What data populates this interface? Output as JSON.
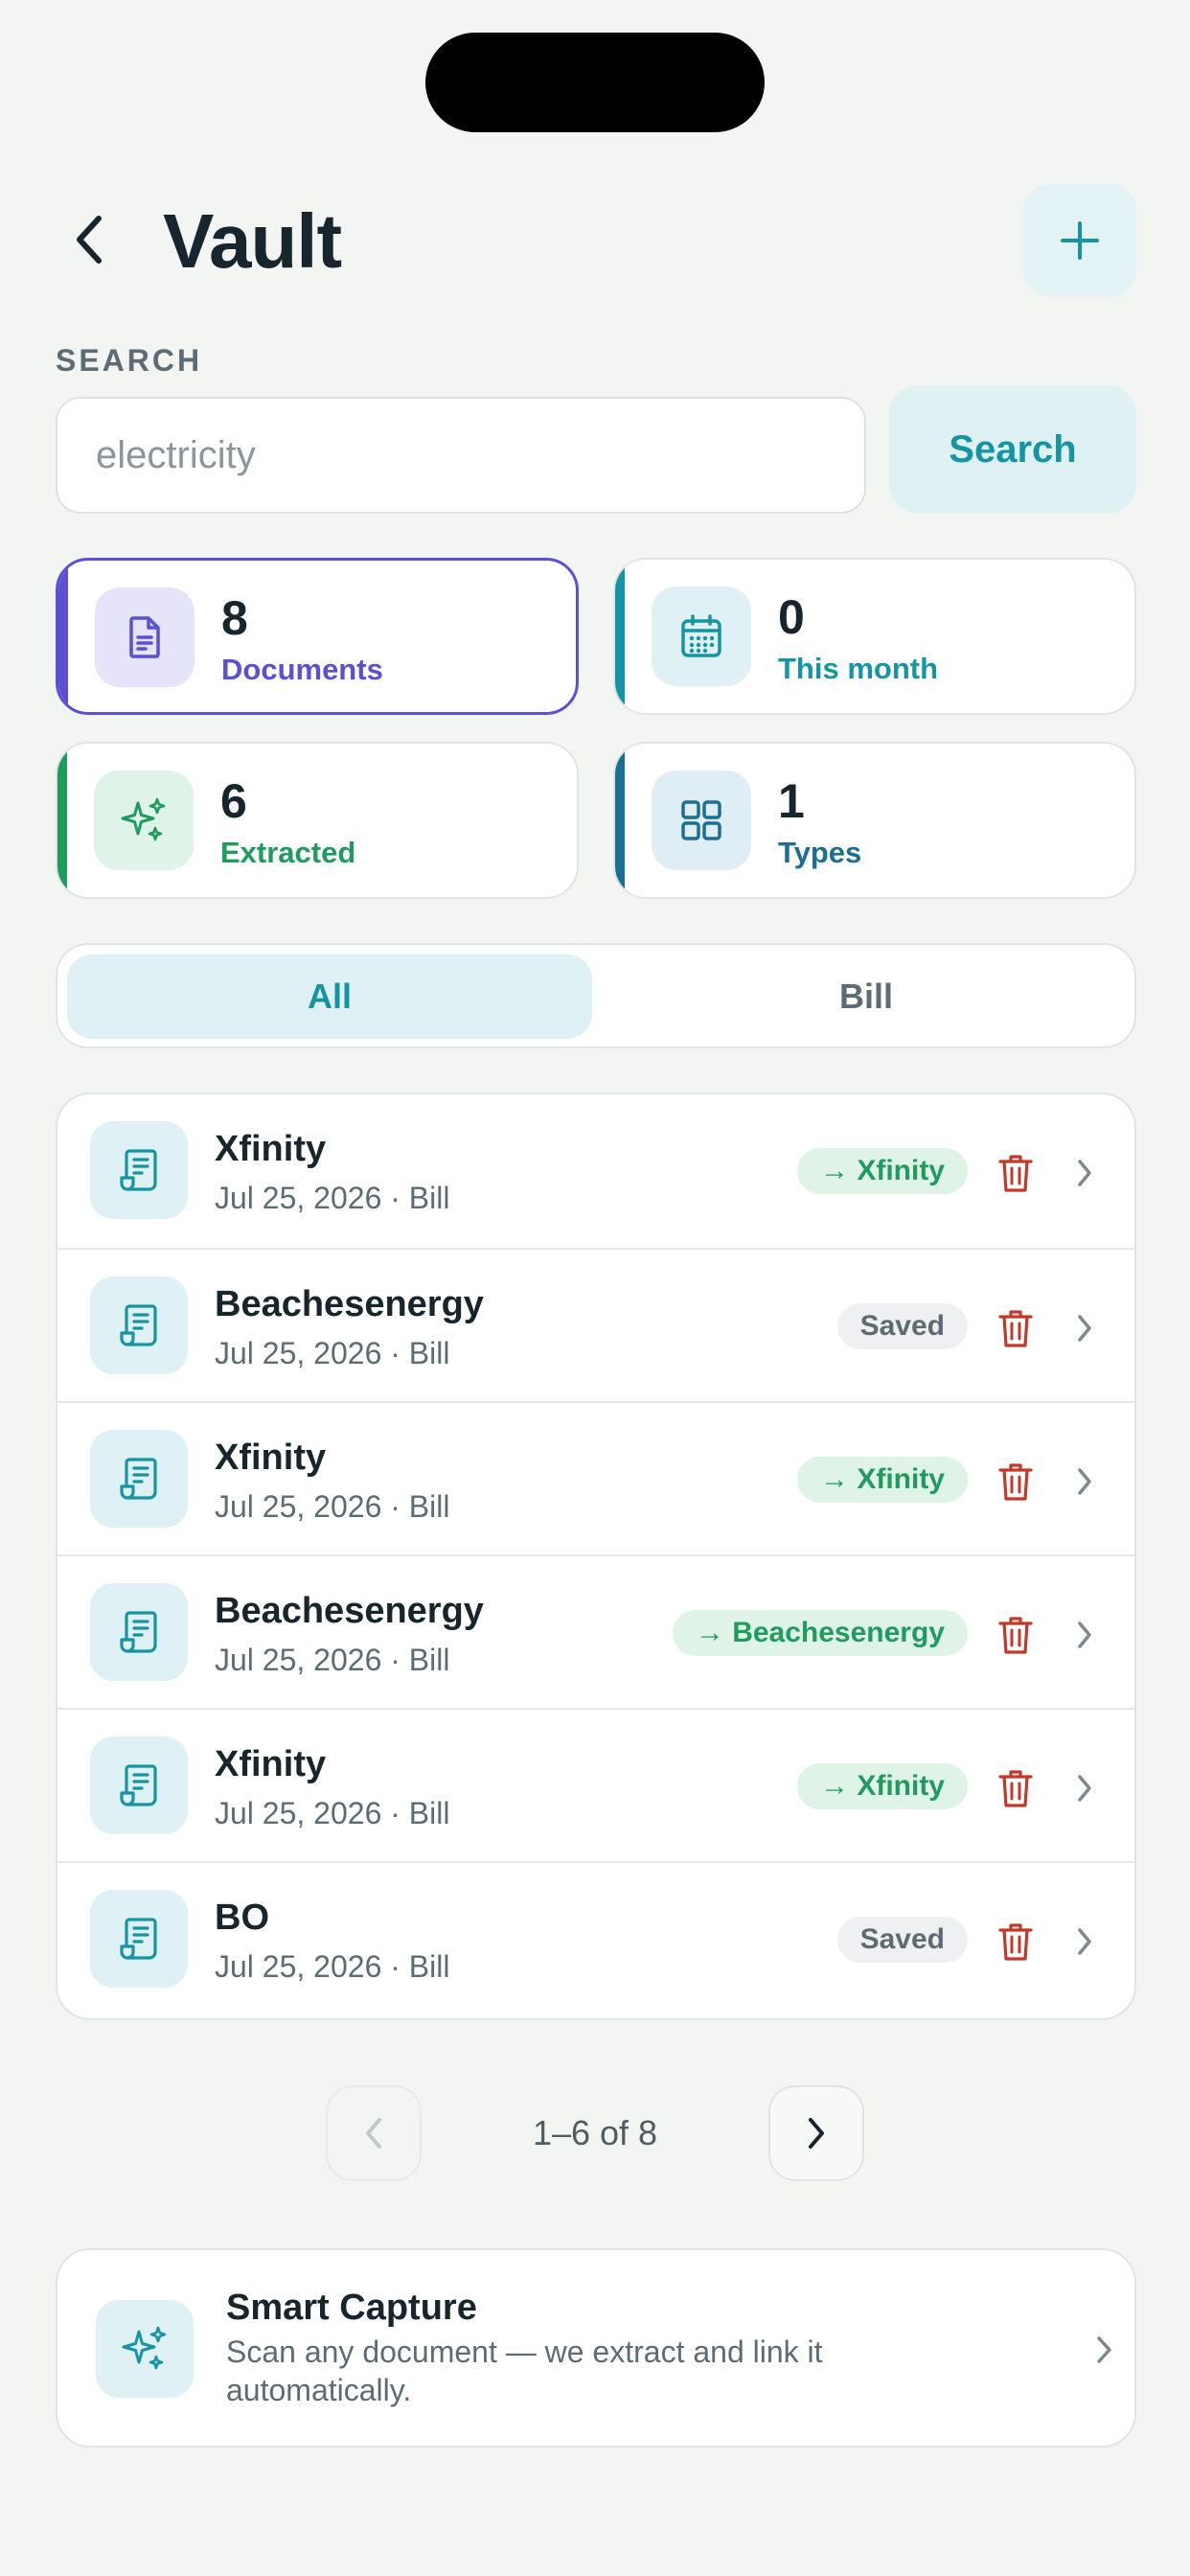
{
  "header": {
    "title": "Vault",
    "back_icon": "chevron-left-icon",
    "add_icon": "plus-icon"
  },
  "search": {
    "label": "SEARCH",
    "placeholder": "electricity",
    "button_label": "Search"
  },
  "stats": [
    {
      "value": "8",
      "label": "Documents",
      "icon": "document-icon",
      "active": true
    },
    {
      "value": "0",
      "label": "This month",
      "icon": "calendar-icon",
      "active": false
    },
    {
      "value": "6",
      "label": "Extracted",
      "icon": "sparkles-icon",
      "active": false
    },
    {
      "value": "1",
      "label": "Types",
      "icon": "grid-icon",
      "active": false
    }
  ],
  "filter": {
    "options": [
      "All",
      "Bill"
    ],
    "selected": "All"
  },
  "documents": [
    {
      "name": "Xfinity",
      "meta": "Jul 25, 2026 · Bill",
      "badge": "→ Xfinity",
      "status": "linked"
    },
    {
      "name": "Beachesenergy",
      "meta": "Jul 25, 2026 · Bill",
      "badge": "Saved",
      "status": "saved"
    },
    {
      "name": "Xfinity",
      "meta": "Jul 25, 2026 · Bill",
      "badge": "→ Xfinity",
      "status": "linked"
    },
    {
      "name": "Beachesenergy",
      "meta": "Jul 25, 2026 · Bill",
      "badge": "→ Beachesenergy",
      "status": "linked"
    },
    {
      "name": "Xfinity",
      "meta": "Jul 25, 2026 · Bill",
      "badge": "→ Xfinity",
      "status": "linked"
    },
    {
      "name": "BO",
      "meta": "Jul 25, 2026 · Bill",
      "badge": "Saved",
      "status": "saved"
    }
  ],
  "pagination": {
    "text": "1–6 of 8"
  },
  "smart_capture": {
    "title": "Smart Capture",
    "description": "Scan any document — we extract and link it automatically."
  },
  "colors": {
    "accent_teal": "#1595a2",
    "accent_purple": "#5b4fd6",
    "accent_green": "#1f9b5e",
    "accent_blue": "#1b6f93",
    "delete_red": "#c0392b"
  }
}
